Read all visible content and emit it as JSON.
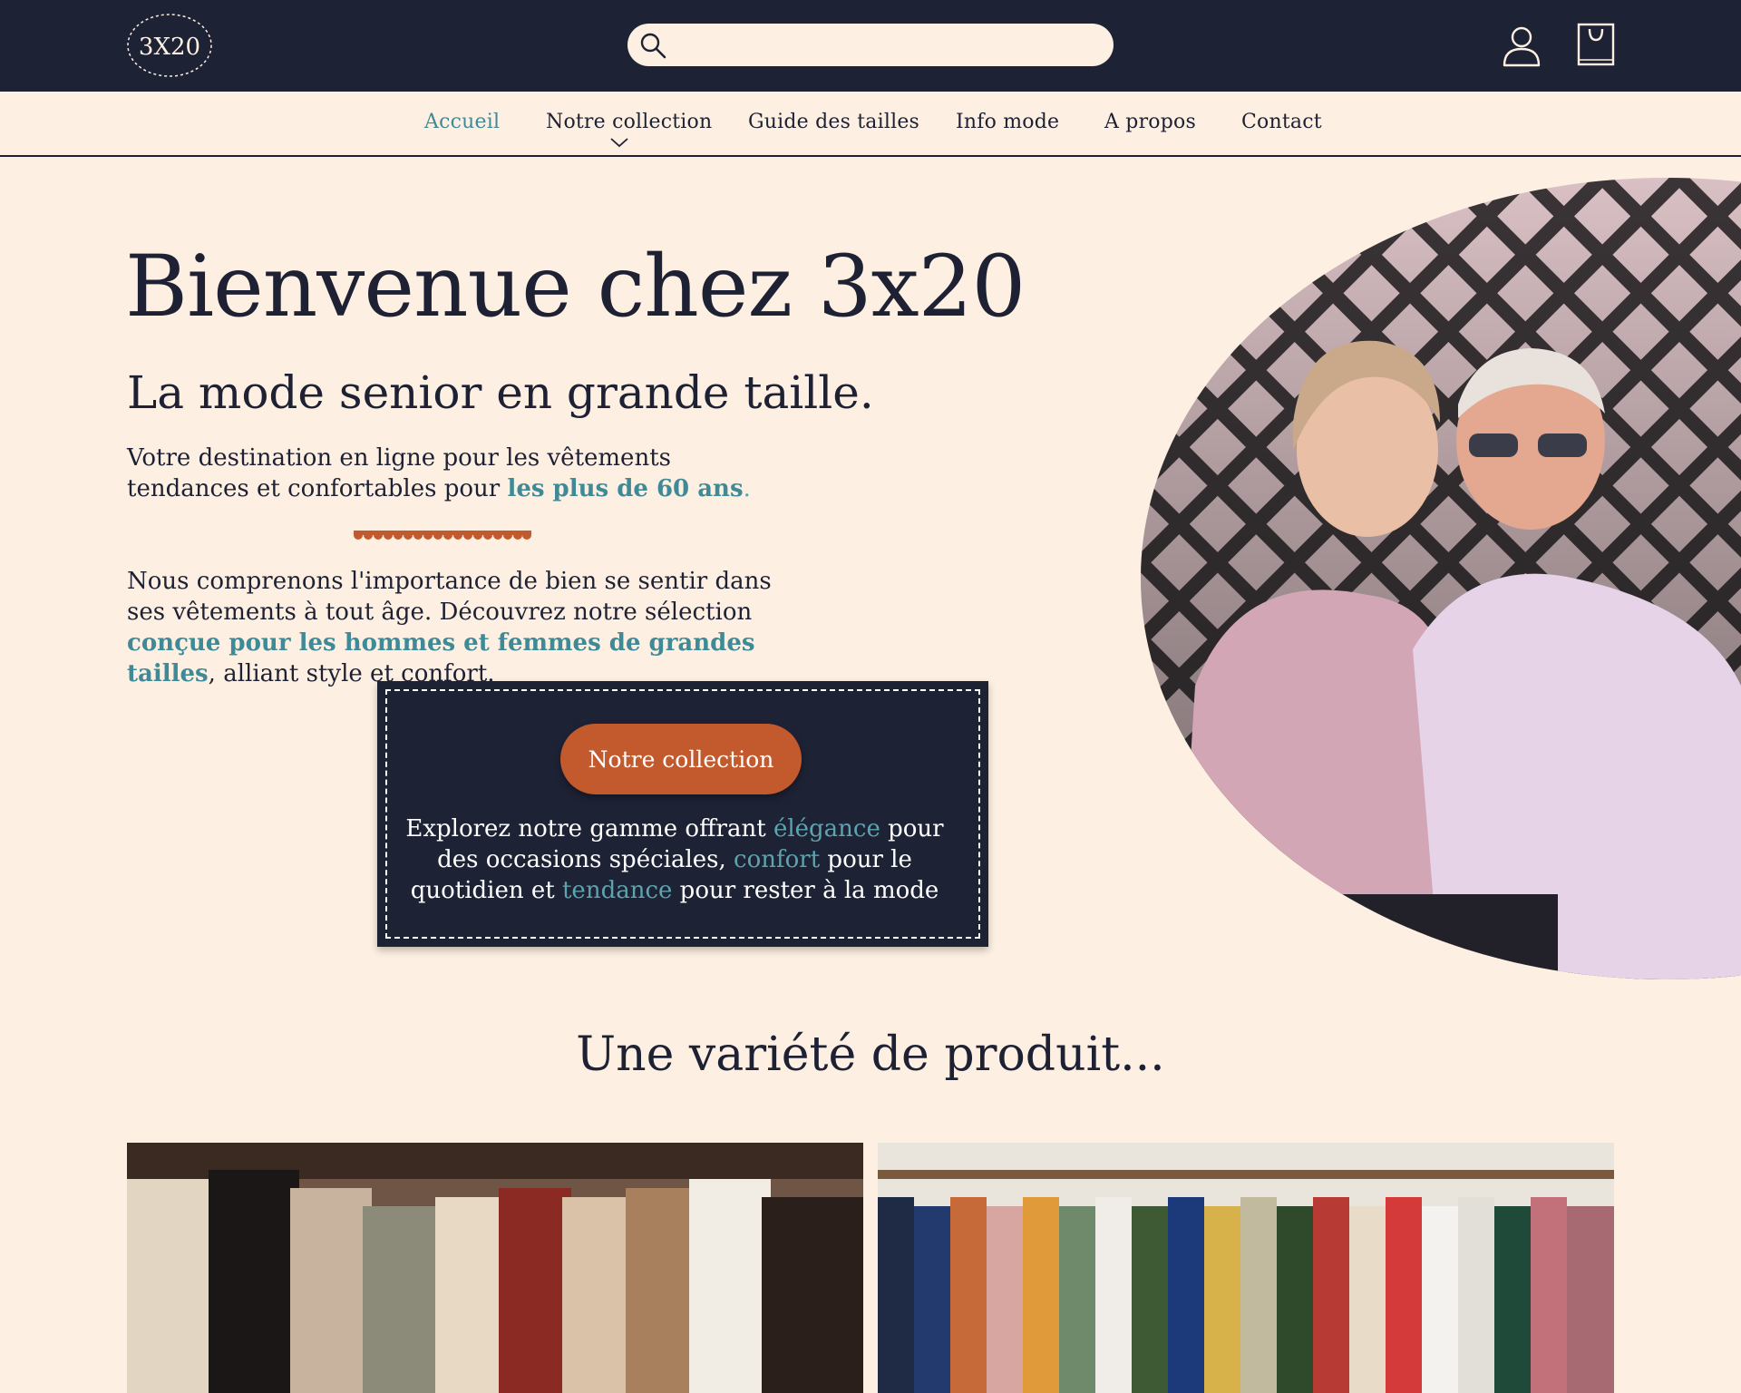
{
  "brand": {
    "logo_text": "3X20",
    "accent": "#3f8a96",
    "orange": "#c25a2e",
    "navy": "#1e2235",
    "cream": "#fdf0e2"
  },
  "header": {
    "search_placeholder": "",
    "icons": [
      "search-icon",
      "user-icon",
      "shopping-bag-icon"
    ]
  },
  "nav": {
    "items": [
      {
        "label": "Accueil",
        "active": true
      },
      {
        "label": "Notre collection",
        "dropdown": true
      },
      {
        "label": "Guide des tailles"
      },
      {
        "label": "Info mode"
      },
      {
        "label": "A propos"
      },
      {
        "label": "Contact"
      }
    ]
  },
  "hero": {
    "title": "Bienvenue chez 3x20",
    "subtitle": "La mode senior en grande taille.",
    "intro_1": "Votre destination en ligne pour les vêtements tendances et confortables pour ",
    "intro_accent": "les plus de 60 ans",
    "intro_end": ".",
    "para_1": "Nous comprenons l'importance de bien se sentir dans ses vêtements à tout âge. Découvrez notre sélection ",
    "para_accent": "conçue pour les hommes et femmes de grandes tailles",
    "para_2": ", alliant style et confort."
  },
  "cta": {
    "button": "Notre collection",
    "text_1": "Explorez notre gamme offrant ",
    "word_1": "élégance",
    "text_2": " pour des occasions spéciales, ",
    "word_2": "confort",
    "text_3": " pour le quotidien et ",
    "word_3": "tendance",
    "text_4": " pour rester à la mode"
  },
  "products": {
    "heading": "Une variété de produit..."
  }
}
